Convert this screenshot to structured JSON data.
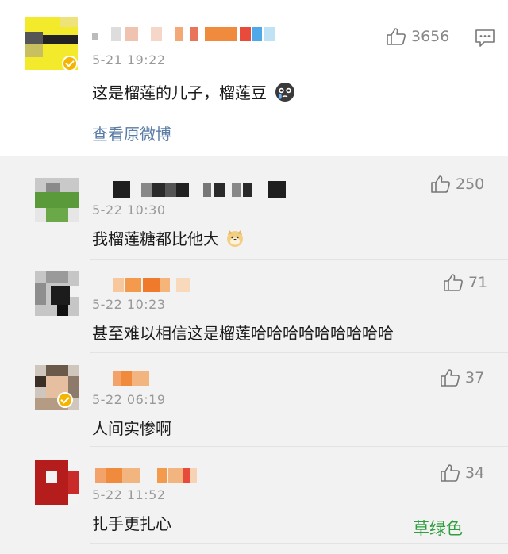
{
  "main_post_comment": {
    "timestamp": "5-21 19:22",
    "text": "这是榴莲的儿子，榴莲豆",
    "likes": "3656",
    "view_original": "查看原微博"
  },
  "replies": [
    {
      "timestamp": "5-22 10:30",
      "text": "我榴莲糖都比他大",
      "likes": "250"
    },
    {
      "timestamp": "5-22 10:23",
      "text": "甚至难以相信这是榴莲哈哈哈哈哈哈哈哈哈",
      "likes": "71"
    },
    {
      "timestamp": "5-22 06:19",
      "text": "人间实惨啊",
      "likes": "37"
    },
    {
      "timestamp": "5-22 11:52",
      "text": "扎手更扎心",
      "likes": "34"
    }
  ],
  "watermark": "草绿色",
  "icons": {
    "like": "thumbs-up-icon",
    "comment": "comment-icon",
    "crying_emoji": "crying-face-icon",
    "doge_emoji": "doge-icon",
    "verified": "verified-badge-icon"
  },
  "colors": {
    "link": "#5b7ca5",
    "verified_badge": "#f4b400",
    "watermark": "#2e9e3e",
    "background": "#f2f2f2"
  }
}
